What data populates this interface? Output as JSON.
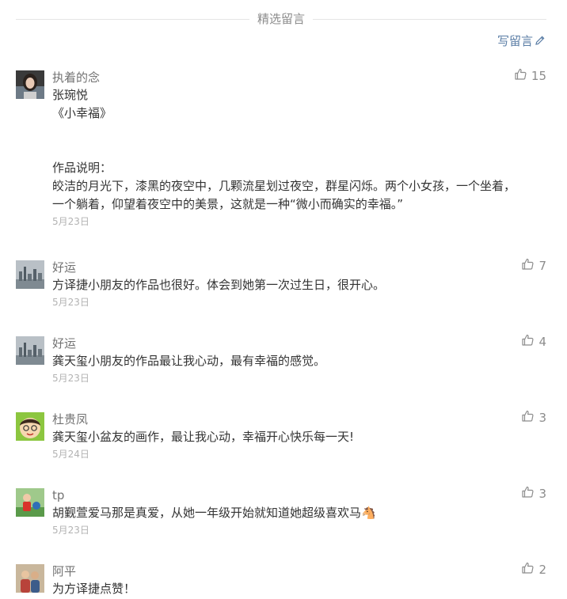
{
  "header": {
    "title": "精选留言",
    "write_label": "写留言"
  },
  "colors": {
    "link": "#5b7ea6",
    "muted": "#8c8c8c",
    "text": "#333333",
    "date": "#b3b3b3"
  },
  "comments": [
    {
      "nick": "执着的念",
      "likes": "15",
      "lines": [
        "张琬悦",
        "《小幸福》",
        "",
        "",
        "作品说明：",
        "皎洁的月光下，漆黑的夜空中，几颗流星划过夜空，群星闪烁。两个小女孩，一个坐着，一个躺着，仰望着夜空中的美景，这就是一种“微小而确实的幸福。”"
      ],
      "date": "5月23日",
      "avatar_icon": "girl-portrait-avatar"
    },
    {
      "nick": "好运",
      "likes": "7",
      "lines": [
        "方译捷小朋友的作品也很好。体会到她第一次过生日，很开心。"
      ],
      "date": "5月23日",
      "avatar_icon": "city-skyline-avatar"
    },
    {
      "nick": "好运",
      "likes": "4",
      "lines": [
        "龚天玺小朋友的作品最让我心动，最有幸福的感觉。"
      ],
      "date": "5月23日",
      "avatar_icon": "city-skyline-avatar"
    },
    {
      "nick": "杜贵凤",
      "likes": "3",
      "lines": [
        "龚天玺小盆友的画作，最让我心动，幸福开心快乐每一天!"
      ],
      "date": "5月24日",
      "avatar_icon": "cartoon-face-avatar"
    },
    {
      "nick": "tp",
      "likes": "3",
      "lines": [
        "胡觐萱爱马那是真爱，从她一年级开始就知道她超级喜欢马🐴"
      ],
      "date": "5月23日",
      "avatar_icon": "outdoor-photo-avatar"
    },
    {
      "nick": "阿平",
      "likes": "2",
      "lines": [
        "为方译捷点赞！"
      ],
      "date": "",
      "avatar_icon": "people-photo-avatar"
    }
  ]
}
